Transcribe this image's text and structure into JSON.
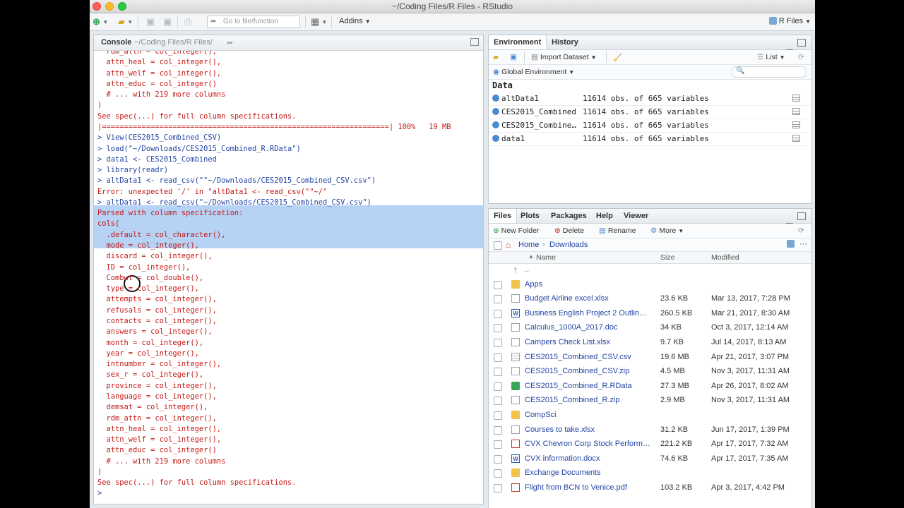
{
  "window": {
    "title": "~/Coding Files/R Files - RStudio"
  },
  "toolbar": {
    "goto_placeholder": "Go to file/function",
    "addins": "Addins",
    "project": "R Files"
  },
  "console": {
    "tab": "Console",
    "path": "~/Coding Files/R Files/",
    "lines": [
      "  rdm_attn = col_integer(),",
      "  attn_heal = col_integer(),",
      "  attn_welf = col_integer(),",
      "  attn_educ = col_integer()",
      "  # ... with 219 more columns",
      ")",
      "See spec(...) for full column specifications.",
      "|=================================================================| 100%   19 MB",
      "> View(CES2015_Combined_CSV)",
      "> load(\"~/Downloads/CES2015_Combined_R.RData\")",
      "> data1 <- CES2015_Combined",
      "> library(readr)",
      "> altData1 <- read_csv(\"\"~/Downloads/CES2015_Combined_CSV.csv\")",
      "Error: unexpected '/' in \"altData1 <- read_csv(\"\"~/\"",
      "> altData1 <- read_csv(\"~/Downloads/CES2015_Combined_CSV.csv\")",
      "Parsed with column specification:",
      "cols(",
      "  .default = col_character(),",
      "  mode = col_integer(),",
      "  discard = col_integer(),",
      "  ID = col_integer(),",
      "  Combwt = col_double(),",
      "  type = col_integer(),",
      "  attempts = col_integer(),",
      "  refusals = col_integer(),",
      "  contacts = col_integer(),",
      "  answers = col_integer(),",
      "  month = col_integer(),",
      "  year = col_integer(),",
      "  intnumber = col_integer(),",
      "  sex_r = col_integer(),",
      "  province = col_integer(),",
      "  language = col_integer(),",
      "  demsat = col_integer(),",
      "  rdm_attn = col_integer(),",
      "  attn_heal = col_integer(),",
      "  attn_welf = col_integer(),",
      "  attn_educ = col_integer()",
      "  # ... with 219 more columns",
      ")",
      "See spec(...) for full column specifications.",
      ">"
    ]
  },
  "environment": {
    "tabs": [
      "Environment",
      "History"
    ],
    "import_dataset": "Import Dataset",
    "list_label": "List",
    "scope": "Global Environment",
    "section": "Data",
    "rows": [
      {
        "name": "altData1",
        "value": "11614 obs. of 665 variables"
      },
      {
        "name": "CES2015_Combined",
        "value": "11614 obs. of 665 variables"
      },
      {
        "name": "CES2015_Combined…",
        "value": "11614 obs. of 665 variables"
      },
      {
        "name": "data1",
        "value": "11614 obs. of 665 variables"
      }
    ]
  },
  "files": {
    "tabs": [
      "Files",
      "Plots",
      "Packages",
      "Help",
      "Viewer"
    ],
    "actions": {
      "new_folder": "New Folder",
      "delete": "Delete",
      "rename": "Rename",
      "more": "More"
    },
    "breadcrumb": [
      "Home",
      "Downloads"
    ],
    "columns": {
      "name": "Name",
      "size": "Size",
      "modified": "Modified"
    },
    "rows": [
      {
        "name": "..",
        "size": "",
        "modified": "",
        "type": "up"
      },
      {
        "name": "Apps",
        "size": "",
        "modified": "",
        "type": "folder"
      },
      {
        "name": "Budget Airline excel.xlsx",
        "size": "23.6 KB",
        "modified": "Mar 13, 2017, 7:28 PM",
        "type": "doc"
      },
      {
        "name": "Business English Project 2 Outlin…",
        "size": "260.5 KB",
        "modified": "Mar 21, 2017, 8:30 AM",
        "type": "word"
      },
      {
        "name": "Calculus_1000A_2017.doc",
        "size": "34 KB",
        "modified": "Oct 3, 2017, 12:14 AM",
        "type": "doc"
      },
      {
        "name": "Campers Check List.xlsx",
        "size": "9.7 KB",
        "modified": "Jul 14, 2017, 8:13 AM",
        "type": "doc"
      },
      {
        "name": "CES2015_Combined_CSV.csv",
        "size": "19.6 MB",
        "modified": "Apr 21, 2017, 3:07 PM",
        "type": "csv"
      },
      {
        "name": "CES2015_Combined_CSV.zip",
        "size": "4.5 MB",
        "modified": "Nov 3, 2017, 11:31 AM",
        "type": "doc"
      },
      {
        "name": "CES2015_Combined_R.RData",
        "size": "27.3 MB",
        "modified": "Apr 26, 2017, 8:02 AM",
        "type": "rdata"
      },
      {
        "name": "CES2015_Combined_R.zip",
        "size": "2.9 MB",
        "modified": "Nov 3, 2017, 11:31 AM",
        "type": "doc"
      },
      {
        "name": "CompSci",
        "size": "",
        "modified": "",
        "type": "folder"
      },
      {
        "name": "Courses to take.xlsx",
        "size": "31.2 KB",
        "modified": "Jun 17, 2017, 1:39 PM",
        "type": "doc"
      },
      {
        "name": "CVX Chevron Corp Stock Perform…",
        "size": "221.2 KB",
        "modified": "Apr 17, 2017, 7:32 AM",
        "type": "pdf"
      },
      {
        "name": "CVX information.docx",
        "size": "74.6 KB",
        "modified": "Apr 17, 2017, 7:35 AM",
        "type": "word"
      },
      {
        "name": "Exchange Documents",
        "size": "",
        "modified": "",
        "type": "folder"
      },
      {
        "name": "Flight from BCN to Venice.pdf",
        "size": "103.2 KB",
        "modified": "Apr 3, 2017, 4:42 PM",
        "type": "pdf"
      }
    ]
  },
  "colors": {
    "console_red": "#c41a16",
    "console_blue": "#2345a5",
    "selection": "#b6d2f4",
    "link_blue": "#2345a5"
  }
}
